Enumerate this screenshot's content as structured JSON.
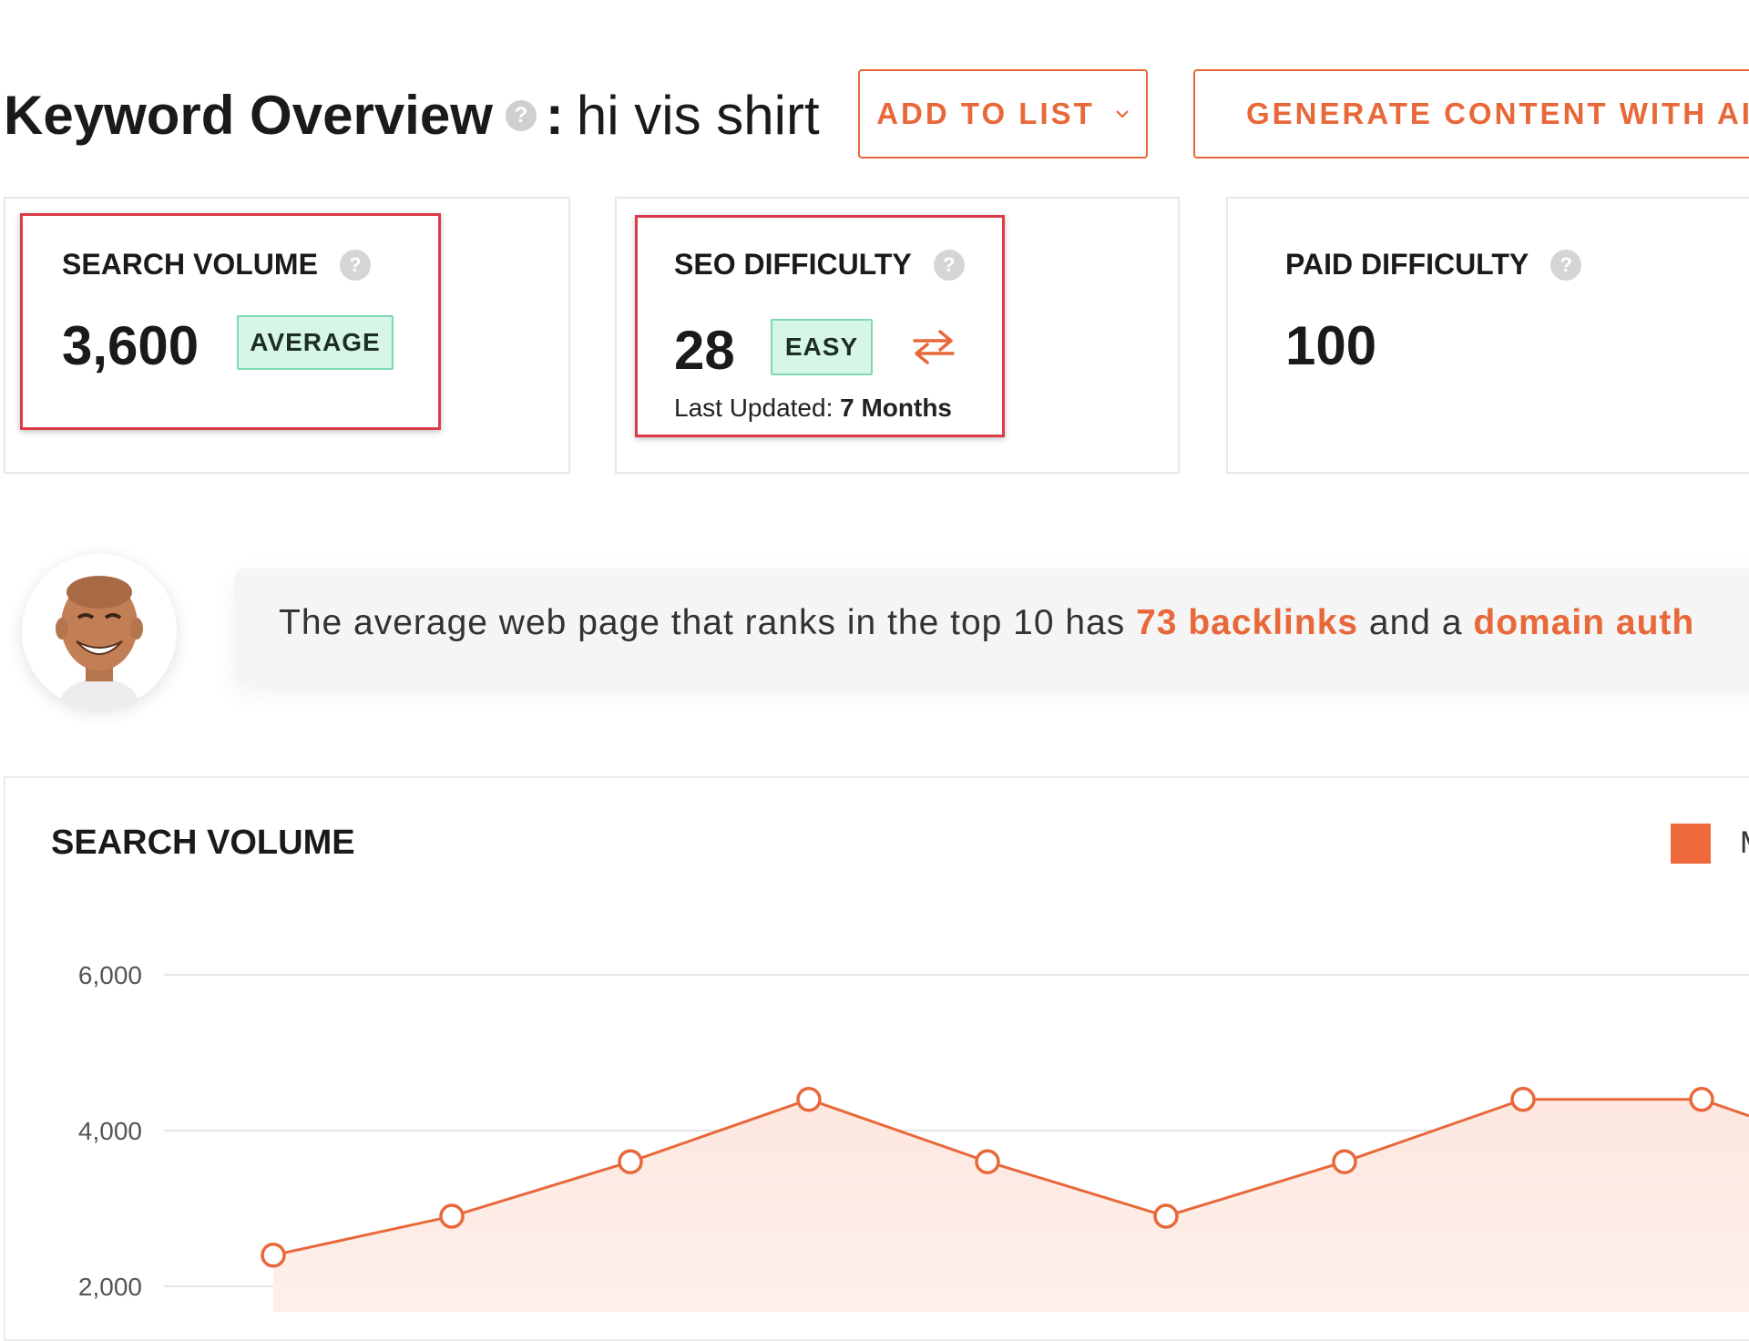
{
  "header": {
    "title": "Keyword Overview",
    "help_glyph": "?",
    "separator": ":",
    "keyword": "hi vis shirt",
    "add_to_list_label": "ADD TO LIST",
    "generate_ai_label": "GENERATE CONTENT WITH AI"
  },
  "metrics": {
    "search_volume": {
      "label": "SEARCH VOLUME",
      "value": "3,600",
      "badge": "AVERAGE"
    },
    "seo_difficulty": {
      "label": "SEO DIFFICULTY",
      "value": "28",
      "badge": "EASY",
      "updated_prefix": "Last Updated:",
      "updated_value": "7 Months"
    },
    "paid_difficulty": {
      "label": "PAID DIFFICULTY",
      "value": "100"
    }
  },
  "tip": {
    "text_1": "The average web page that ranks in the top 10 has ",
    "backlinks": "73 backlinks",
    "text_2": " and a ",
    "domain": "domain auth"
  },
  "chart": {
    "title": "SEARCH VOLUME",
    "legend_label": "M"
  },
  "colors": {
    "accent": "#e8683a",
    "highlight_box": "#dd3a48",
    "badge_bg": "#d6f7e8",
    "badge_border": "#7fd8b0"
  },
  "chart_data": {
    "type": "area",
    "title": "SEARCH VOLUME",
    "xlabel": "",
    "ylabel": "",
    "y_ticks": [
      "6,000",
      "4,000",
      "2,000"
    ],
    "y_tick_values": [
      6000,
      4000,
      2000
    ],
    "ylim": [
      1700,
      6300
    ],
    "grid": true,
    "legend": "top-right",
    "series": [
      {
        "name": "M",
        "values": [
          2400,
          2900,
          3600,
          4400,
          3600,
          2900,
          3600,
          4400,
          4400
        ]
      }
    ]
  }
}
